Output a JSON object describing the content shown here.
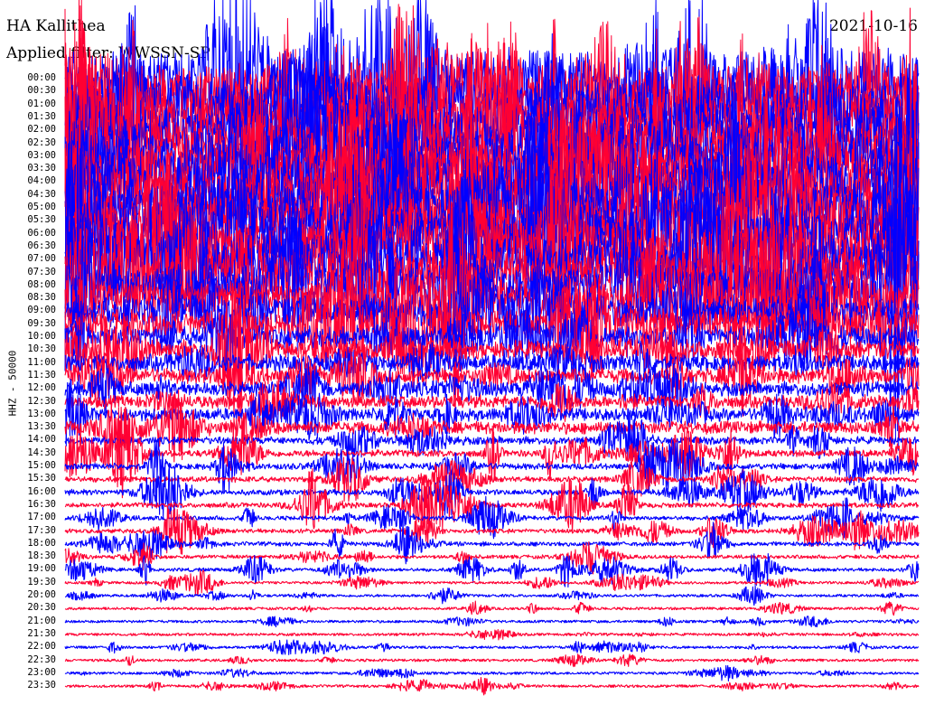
{
  "header": {
    "station": "HA Kallithea",
    "date": "2021-10-16",
    "filter": "Applied filter: WWSSN-SP"
  },
  "axis": {
    "channel_label": "HHZ - 50000"
  },
  "colors": {
    "trace_a": "#0000ff",
    "trace_b": "#ff0033",
    "background": "#ffffff"
  },
  "chart_data": {
    "type": "line",
    "title": "HA Kallithea",
    "subtitle": "Applied filter: WWSSN-SP",
    "date": "2021-10-16",
    "ylabel": "HHZ - 50000",
    "row_labels": [
      "00:00",
      "00:30",
      "01:00",
      "01:30",
      "02:00",
      "02:30",
      "03:00",
      "03:30",
      "04:00",
      "04:30",
      "05:00",
      "05:30",
      "06:00",
      "06:30",
      "07:00",
      "07:30",
      "08:00",
      "08:30",
      "09:00",
      "09:30",
      "10:00",
      "10:30",
      "11:00",
      "11:30",
      "12:00",
      "12:30",
      "13:00",
      "13:30",
      "14:00",
      "14:30",
      "15:00",
      "15:30",
      "16:00",
      "16:30",
      "17:00",
      "17:30",
      "18:00",
      "18:30",
      "19:00",
      "19:30",
      "20:00",
      "20:30",
      "21:00",
      "21:30",
      "22:00",
      "22:30",
      "23:00",
      "23:30"
    ],
    "row_colors": [
      "blue",
      "red"
    ],
    "relative_amplitude": [
      4.5,
      4.5,
      4.6,
      4.6,
      4.7,
      4.7,
      4.8,
      4.8,
      4.8,
      4.7,
      4.6,
      4.5,
      4.4,
      4.2,
      4.0,
      3.8,
      3.4,
      3.0,
      2.6,
      2.2,
      1.8,
      1.5,
      1.3,
      1.2,
      1.1,
      1.0,
      1.0,
      1.0,
      0.6,
      0.55,
      0.5,
      0.45,
      0.45,
      0.4,
      0.35,
      0.35,
      0.35,
      0.3,
      0.28,
      0.15,
      0.12,
      0.14,
      0.1,
      0.1,
      0.14,
      0.12,
      0.1,
      0.1
    ],
    "grid": false,
    "legend": "none"
  }
}
